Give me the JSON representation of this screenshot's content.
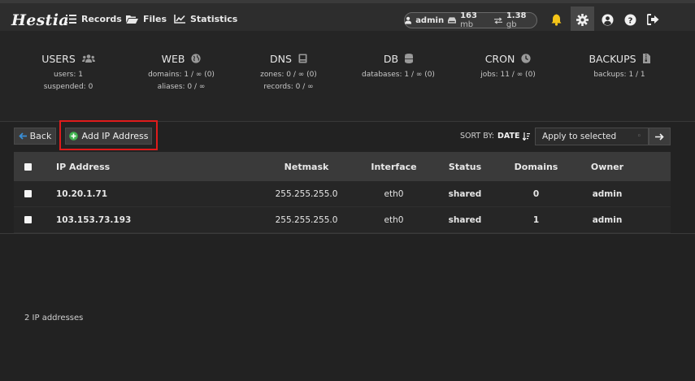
{
  "app": {
    "logo": "Hestia"
  },
  "nav": {
    "records": "Records",
    "files": "Files",
    "statistics": "Statistics"
  },
  "usage": {
    "user": "admin",
    "disk_value": "163",
    "disk_unit": "mb",
    "bw_value": "1.38",
    "bw_unit": "gb"
  },
  "stats": {
    "users": {
      "title": "USERS",
      "line1": "users: 1",
      "line2": "suspended: 0"
    },
    "web": {
      "title": "WEB",
      "line1": "domains: 1 / ∞ (0)",
      "line2": "aliases: 0 / ∞"
    },
    "dns": {
      "title": "DNS",
      "line1": "zones: 0 / ∞ (0)",
      "line2": "records: 0 / ∞"
    },
    "db": {
      "title": "DB",
      "line1": "databases: 1 / ∞ (0)"
    },
    "cron": {
      "title": "CRON",
      "line1": "jobs: 11 / ∞ (0)"
    },
    "backups": {
      "title": "BACKUPS",
      "line1": "backups: 1 / 1"
    }
  },
  "toolbar": {
    "back_label": "Back",
    "add_label": "Add IP Address",
    "sort_label": "SORT BY:",
    "sort_value": "DATE",
    "bulk_select": "Apply to selected"
  },
  "table": {
    "headers": {
      "ip": "IP Address",
      "netmask": "Netmask",
      "interface": "Interface",
      "status": "Status",
      "domains": "Domains",
      "owner": "Owner"
    },
    "rows": [
      {
        "ip": "10.20.1.71",
        "netmask": "255.255.255.0",
        "interface": "eth0",
        "status": "shared",
        "domains": "0",
        "owner": "admin"
      },
      {
        "ip": "103.153.73.193",
        "netmask": "255.255.255.0",
        "interface": "eth0",
        "status": "shared",
        "domains": "1",
        "owner": "admin"
      }
    ]
  },
  "footer": {
    "count": "2 IP addresses"
  },
  "colors": {
    "accent_red": "#e01b1b",
    "add_green": "#3fb34f",
    "back_blue": "#3a8fd6",
    "bell_yellow": "#f5c518"
  }
}
